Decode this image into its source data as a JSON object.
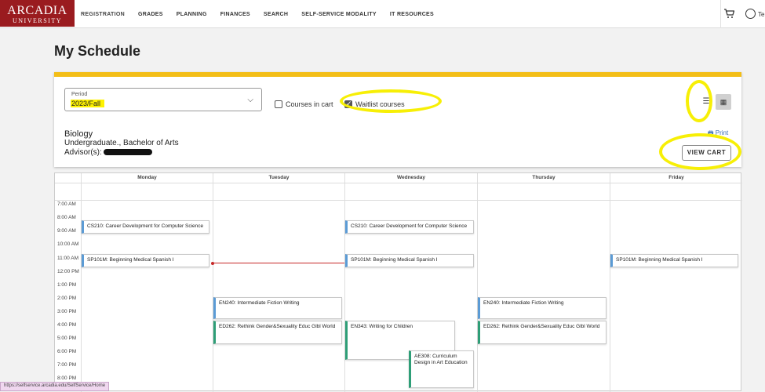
{
  "logo": {
    "line1": "ARCADIA",
    "line2": "UNIVERSITY"
  },
  "nav": [
    "REGISTRATION",
    "GRADES",
    "PLANNING",
    "FINANCES",
    "SEARCH",
    "SELF-SERVICE MODALITY",
    "IT RESOURCES"
  ],
  "header": {
    "cart_icon": "cart-icon",
    "user_icon": "user-icon",
    "user_initial": "Te"
  },
  "page_title": "My Schedule",
  "filters": {
    "period_label": "Period",
    "period_value": "2023/Fall",
    "courses_in_cart_label": "Courses in cart",
    "courses_in_cart_checked": false,
    "waitlist_label": "Waitlist courses",
    "waitlist_checked": true
  },
  "program": {
    "name": "Biology",
    "degree": "Undergraduate., Bachelor of Arts",
    "advisor_label": "Advisor(s):"
  },
  "actions": {
    "print_label": "Print",
    "view_cart_label": "VIEW CART"
  },
  "calendar": {
    "days": [
      "Monday",
      "Tuesday",
      "Wednesday",
      "Thursday",
      "Friday"
    ],
    "times": [
      "7:00 AM",
      "8:00 AM",
      "9:00 AM",
      "10:00 AM",
      "11:00 AM",
      "12:00 PM",
      "1:00 PM",
      "2:00 PM",
      "3:00 PM",
      "4:00 PM",
      "5:00 PM",
      "6:00 PM",
      "7:00 PM",
      "8:00 PM"
    ],
    "events": [
      "CS210: Career Development for Computer Science",
      "CS210: Career Development for Computer Science",
      "SP101M: Beginning Medical Spanish I",
      "SP101M: Beginning Medical Spanish I",
      "SP101M: Beginning Medical Spanish I",
      "EN240: Intermediate Fiction Writing",
      "EN240: Intermediate Fiction Writing",
      "ED262: Rethink Gender&Sexuality Educ Glbl World",
      "ED262: Rethink Gender&Sexuality Educ Glbl World",
      "EN343: Writing for Children",
      "AE308: Curriculum Design in Art Education"
    ]
  },
  "status_url": "https://selfservice.arcadia.edu/SelfService/Home",
  "colors": {
    "brand": "#9a1b1f",
    "accent": "#f3be17",
    "highlight": "#f7ef06",
    "event_blue": "#5b9bd5",
    "event_green": "#2e9e77",
    "link": "#3c6fb5"
  }
}
